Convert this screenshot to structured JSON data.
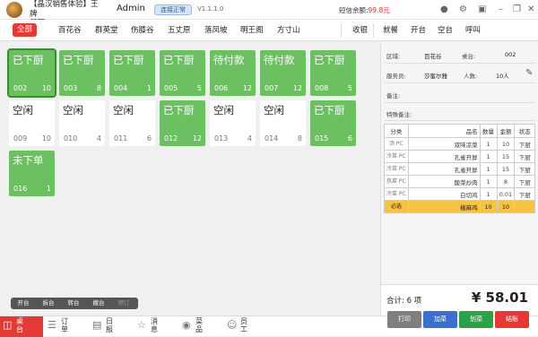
{
  "header": {
    "shop_line1": "【晶汉销售体验】王牌",
    "shop_line2": "餐厅",
    "user": "Admin",
    "connection": "连接正常",
    "version": "V1.1.1.0",
    "sms_label": "短信余额:",
    "sms_value": "99.8元"
  },
  "areas": [
    "全部",
    "百花谷",
    "群英堂",
    "伤膝谷",
    "五丈原",
    "落凤坡",
    "明王阁",
    "方寸山"
  ],
  "actions": [
    "收银",
    "就餐",
    "开台",
    "空台",
    "呼叫"
  ],
  "tables": [
    {
      "status": "已下厨",
      "no": "002",
      "count": "10",
      "color": "green"
    },
    {
      "status": "已下厨",
      "no": "003",
      "count": "8",
      "color": "green"
    },
    {
      "status": "已下厨",
      "no": "004",
      "count": "1",
      "color": "green"
    },
    {
      "status": "已下厨",
      "no": "005",
      "count": "5",
      "color": "green"
    },
    {
      "status": "待付款",
      "no": "006",
      "count": "12",
      "color": "green"
    },
    {
      "status": "待付款",
      "no": "007",
      "count": "12",
      "color": "green"
    },
    {
      "status": "已下厨",
      "no": "008",
      "count": "5",
      "color": "green"
    },
    {
      "status": "空闲",
      "no": "009",
      "count": "10",
      "color": "white"
    },
    {
      "status": "空闲",
      "no": "010",
      "count": "4",
      "color": "white"
    },
    {
      "status": "空闲",
      "no": "011",
      "count": "6",
      "color": "white"
    },
    {
      "status": "已下厨",
      "no": "012",
      "count": "12",
      "color": "green"
    },
    {
      "status": "空闲",
      "no": "013",
      "count": "4",
      "color": "white"
    },
    {
      "status": "空闲",
      "no": "014",
      "count": "8",
      "color": "white"
    },
    {
      "status": "已下厨",
      "no": "015",
      "count": "6",
      "color": "green"
    },
    {
      "status": "未下单",
      "no": "016",
      "count": "1",
      "color": "green"
    }
  ],
  "table_buttons": [
    "开台",
    "拆台",
    "转台",
    "撤台",
    "预订"
  ],
  "order": {
    "area_label": "区域:",
    "area_value": "百花谷",
    "table_label": "桌台:",
    "table_value": "002",
    "waiter_label": "服务员:",
    "waiter_value": "莎蜜尔雅",
    "people_label": "人数:",
    "people_value": "10人",
    "note_label": "备注:",
    "special_label": "特殊备注:",
    "columns": [
      "分类",
      "品名",
      "数量",
      "金额",
      "状态"
    ],
    "rows": [
      {
        "cat": "汤 PC",
        "name": "双味凉菜",
        "qty": "1",
        "amount": "10",
        "status": "下厨"
      },
      {
        "cat": "冷菜 PC",
        "name": "孔雀开屏",
        "qty": "1",
        "amount": "15",
        "status": "下厨"
      },
      {
        "cat": "冷菜 PC",
        "name": "孔雀开屏",
        "qty": "1",
        "amount": "15",
        "status": "下厨"
      },
      {
        "cat": "热菜 PC",
        "name": "酸菜炒肉",
        "qty": "1",
        "amount": "8",
        "status": "下厨"
      },
      {
        "cat": "冷菜 PC",
        "name": "白切鸡",
        "qty": "1",
        "amount": "0.01",
        "status": "下厨"
      },
      {
        "cat": "必选",
        "name": "椒麻鸡",
        "qty": "10",
        "amount": "10",
        "status": ""
      }
    ],
    "total_label": "合计: 6 项",
    "total_value": "¥ 58.01"
  },
  "footer": [
    {
      "label": "桌台",
      "icon": "table-icon"
    },
    {
      "label": "订单",
      "icon": "order-icon"
    },
    {
      "label": "日报",
      "icon": "report-icon"
    },
    {
      "label": "消息",
      "icon": "message-icon"
    },
    {
      "label": "菜品",
      "icon": "dish-icon"
    },
    {
      "label": "员工",
      "icon": "staff-icon"
    }
  ],
  "order_buttons": [
    {
      "label": "打印",
      "color": "#7f7f7f"
    },
    {
      "label": "加菜",
      "color": "#3a6fd0"
    },
    {
      "label": "划菜",
      "color": "#2aa24a"
    },
    {
      "label": "结账",
      "color": "#e53935"
    }
  ],
  "colors": {
    "accent": "#e53935",
    "table_green": "#6cc062",
    "highlight": "#f7c342"
  }
}
